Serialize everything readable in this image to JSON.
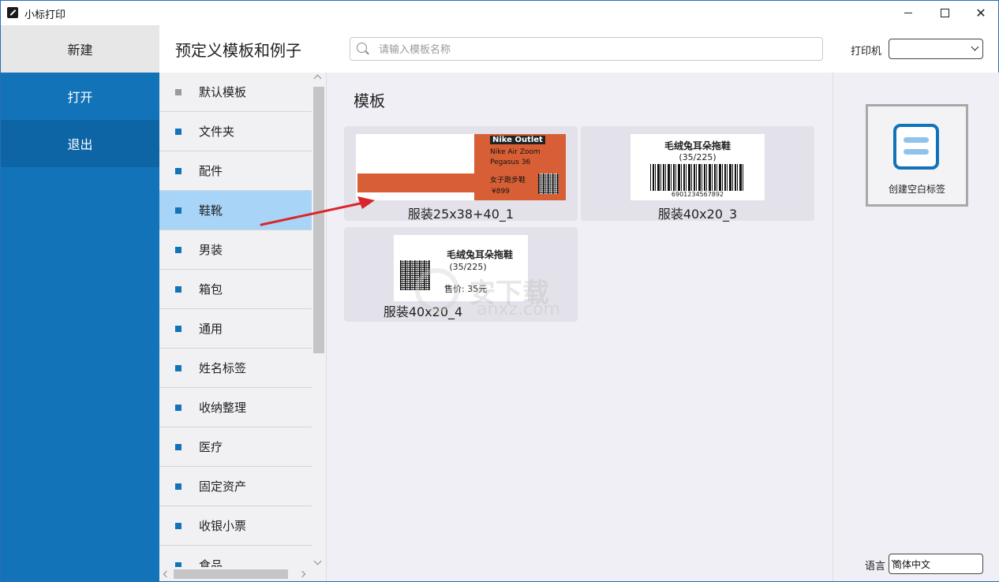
{
  "window": {
    "title": "小标打印"
  },
  "leftnav": {
    "new_label": "新建",
    "open_label": "打开",
    "exit_label": "退出"
  },
  "header": {
    "title": "预定义模板和例子",
    "search_placeholder": "请输入模板名称",
    "printer_label": "打印机",
    "printer_value": ""
  },
  "categories": [
    {
      "label": "默认模板"
    },
    {
      "label": "文件夹"
    },
    {
      "label": "配件"
    },
    {
      "label": "鞋靴"
    },
    {
      "label": "男装"
    },
    {
      "label": "箱包"
    },
    {
      "label": "通用"
    },
    {
      "label": "姓名标签"
    },
    {
      "label": "收纳整理"
    },
    {
      "label": "医疗"
    },
    {
      "label": "固定资产"
    },
    {
      "label": "收银小票"
    },
    {
      "label": "食品"
    }
  ],
  "templates": {
    "section_title": "模板",
    "items": [
      {
        "name": "服装25x38+40_1",
        "brand": "Nike Outlet",
        "line1": "Nike Air Zoom",
        "line2": "Pegasus 36",
        "line3": "女子跑步鞋",
        "price": "¥899"
      },
      {
        "name": "服装40x20_3",
        "product": "毛绒兔耳朵拖鞋",
        "size": "(35/225)",
        "barcode": "6901234567892"
      },
      {
        "name": "服装40x20_4",
        "product": "毛绒兔耳朵拖鞋",
        "size": "(35/225)",
        "price": "售价: 35元"
      }
    ]
  },
  "blank": {
    "label": "创建空白标签"
  },
  "language": {
    "label": "语言",
    "value": "简体中文"
  },
  "watermark": {
    "text": "安下载",
    "sub": "anxz.com"
  },
  "colors": {
    "accent": "#1273b8",
    "active_category": "#a8d4f7",
    "tag_orange": "#d85f35",
    "annotation": "#d9262b"
  }
}
